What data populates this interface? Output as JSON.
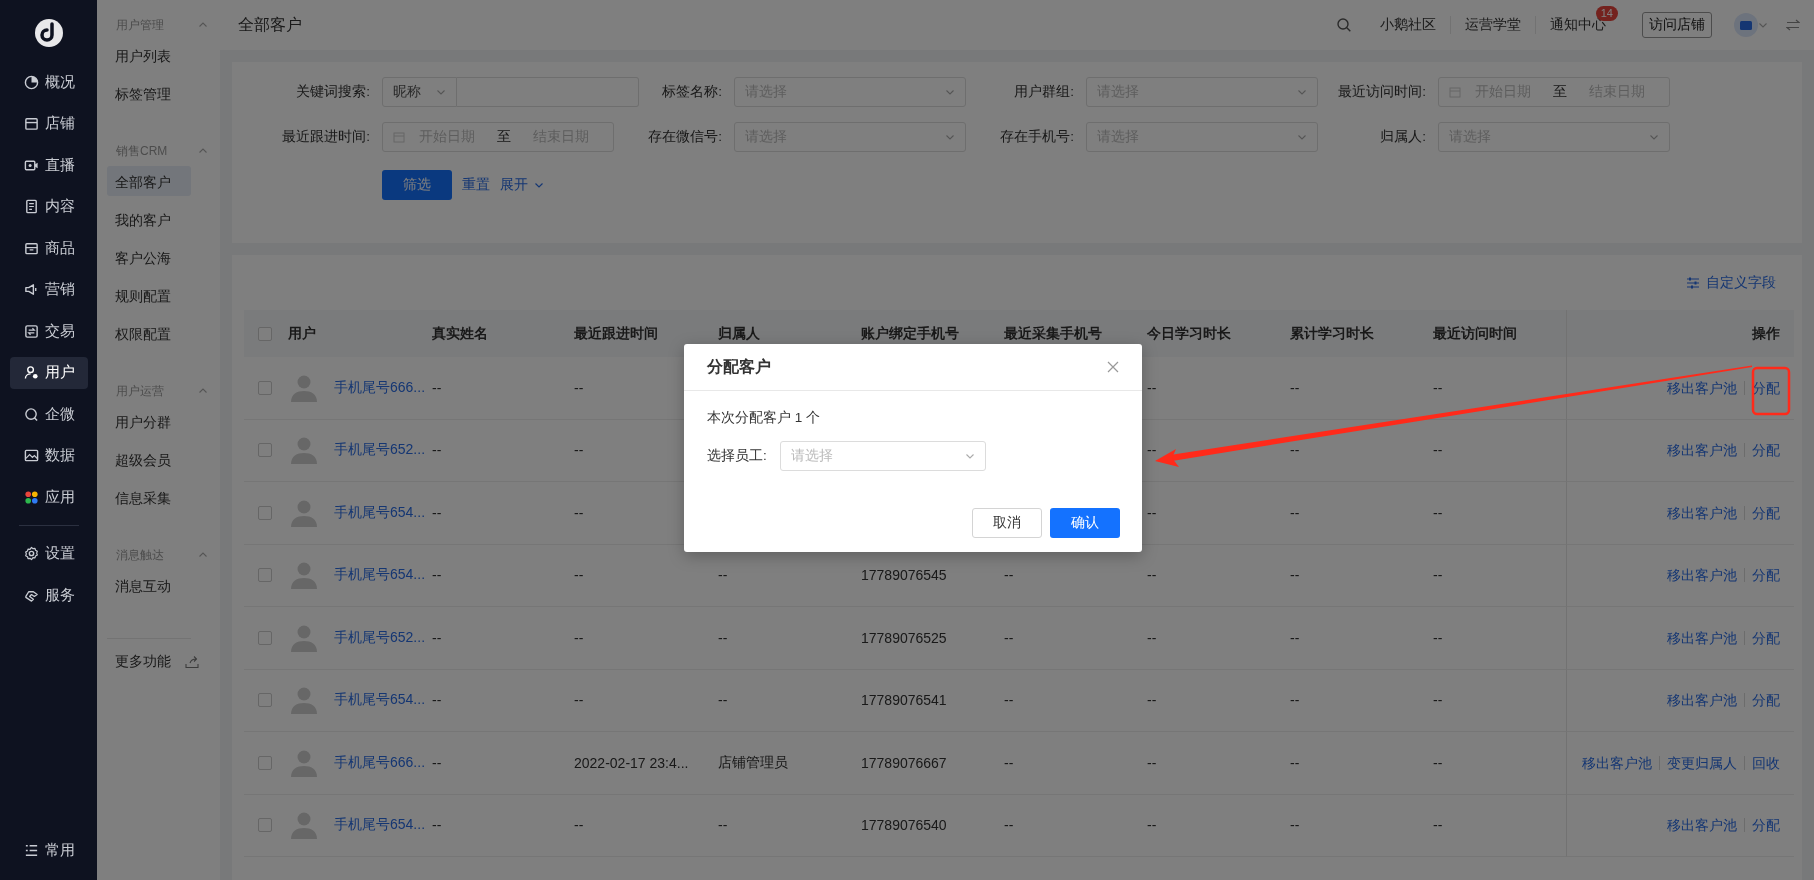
{
  "sidebar": {
    "items": [
      {
        "label": "概况",
        "selected": false
      },
      {
        "label": "店铺",
        "selected": false
      },
      {
        "label": "直播",
        "selected": false
      },
      {
        "label": "内容",
        "selected": false
      },
      {
        "label": "商品",
        "selected": false
      },
      {
        "label": "营销",
        "selected": false
      },
      {
        "label": "交易",
        "selected": false
      },
      {
        "label": "用户",
        "selected": true
      },
      {
        "label": "企微",
        "selected": false
      },
      {
        "label": "数据",
        "selected": false
      },
      {
        "label": "应用",
        "selected": false
      }
    ],
    "settings_items": [
      {
        "label": "设置",
        "selected": false
      },
      {
        "label": "服务",
        "selected": false
      }
    ],
    "bottom_item": "常用"
  },
  "subnav": {
    "groups": [
      {
        "title": "用户管理",
        "expanded": true,
        "items": [
          {
            "label": "用户列表",
            "selected": false
          },
          {
            "label": "标签管理",
            "selected": false
          }
        ]
      },
      {
        "title": "销售CRM",
        "expanded": true,
        "items": [
          {
            "label": "全部客户",
            "selected": true
          },
          {
            "label": "我的客户",
            "selected": false
          },
          {
            "label": "客户公海",
            "selected": false
          },
          {
            "label": "规则配置",
            "selected": false
          },
          {
            "label": "权限配置",
            "selected": false
          }
        ]
      },
      {
        "title": "用户运营",
        "expanded": true,
        "items": [
          {
            "label": "用户分群",
            "selected": false
          },
          {
            "label": "超级会员",
            "selected": false
          },
          {
            "label": "信息采集",
            "selected": false
          }
        ]
      },
      {
        "title": "消息触达",
        "expanded": true,
        "items": [
          {
            "label": "消息互动",
            "selected": false
          }
        ]
      }
    ],
    "more": "更多功能"
  },
  "topbar": {
    "title": "全部客户",
    "links": [
      {
        "label": "小鹅社区"
      },
      {
        "label": "运营学堂"
      },
      {
        "label": "通知中心",
        "badge": "14"
      }
    ],
    "visit_store": "访问店铺"
  },
  "filters": [
    {
      "kind": "keyword",
      "label": "关键词搜索:",
      "select": "昵称"
    },
    {
      "kind": "select",
      "label": "标签名称:",
      "placeholder": "请选择"
    },
    {
      "kind": "select",
      "label": "用户群组:",
      "placeholder": "请选择"
    },
    {
      "kind": "daterange",
      "label": "最近访问时间:",
      "start": "开始日期",
      "separator": "至",
      "end": "结束日期"
    },
    {
      "kind": "daterange",
      "label": "最近跟进时间:",
      "start": "开始日期",
      "separator": "至",
      "end": "结束日期"
    },
    {
      "kind": "select",
      "label": "存在微信号:",
      "placeholder": "请选择"
    },
    {
      "kind": "select",
      "label": "存在手机号:",
      "placeholder": "请选择"
    },
    {
      "kind": "select",
      "label": "归属人:",
      "placeholder": "请选择"
    }
  ],
  "filter_actions": {
    "submit": "筛选",
    "reset": "重置",
    "expand": "展开"
  },
  "table": {
    "customize": "自定义字段",
    "header_checked": false,
    "columns": [
      "用户",
      "真实姓名",
      "最近跟进时间",
      "归属人",
      "账户绑定手机号",
      "最近采集手机号",
      "今日学习时长",
      "累计学习时长",
      "最近访问时间",
      "操作"
    ],
    "rows": [
      {
        "checked": false,
        "user": "手机尾号666...",
        "real_name": "--",
        "follow_time": "--",
        "today_study": "--",
        "total_study": "--",
        "last_visit": "--",
        "actions": [
          "移出客户池",
          "分配"
        ]
      },
      {
        "checked": false,
        "user": "手机尾号652...",
        "real_name": "--",
        "follow_time": "--",
        "today_study": "--",
        "total_study": "--",
        "last_visit": "--",
        "actions": [
          "移出客户池",
          "分配"
        ]
      },
      {
        "checked": false,
        "user": "手机尾号654...",
        "real_name": "--",
        "follow_time": "--",
        "today_study": "--",
        "total_study": "--",
        "last_visit": "--",
        "actions": [
          "移出客户池",
          "分配"
        ]
      },
      {
        "checked": false,
        "user": "手机尾号654...",
        "real_name": "--",
        "follow_time": "--",
        "owner": "--",
        "bound_phone": "17789076545",
        "collected_phone": "--",
        "today_study": "--",
        "total_study": "--",
        "last_visit": "--",
        "actions": [
          "移出客户池",
          "分配"
        ]
      },
      {
        "checked": false,
        "user": "手机尾号652...",
        "real_name": "--",
        "follow_time": "--",
        "owner": "--",
        "bound_phone": "17789076525",
        "collected_phone": "--",
        "today_study": "--",
        "total_study": "--",
        "last_visit": "--",
        "actions": [
          "移出客户池",
          "分配"
        ]
      },
      {
        "checked": false,
        "user": "手机尾号654...",
        "real_name": "--",
        "follow_time": "--",
        "owner": "--",
        "bound_phone": "17789076541",
        "collected_phone": "--",
        "today_study": "--",
        "total_study": "--",
        "last_visit": "--",
        "actions": [
          "移出客户池",
          "分配"
        ]
      },
      {
        "checked": false,
        "user": "手机尾号666...",
        "real_name": "--",
        "follow_time": "2022-02-17 23:4...",
        "owner": "店铺管理员",
        "bound_phone": "17789076667",
        "collected_phone": "--",
        "today_study": "--",
        "total_study": "--",
        "last_visit": "--",
        "actions": [
          "移出客户池",
          "变更归属人",
          "回收"
        ]
      },
      {
        "checked": false,
        "user": "手机尾号654...",
        "real_name": "--",
        "follow_time": "--",
        "owner": "--",
        "bound_phone": "17789076540",
        "collected_phone": "--",
        "today_study": "--",
        "total_study": "--",
        "last_visit": "--",
        "actions": [
          "移出客户池",
          "分配"
        ]
      }
    ]
  },
  "dialog": {
    "title": "分配客户",
    "summary": "本次分配客户 1 个",
    "field_label": "选择员工:",
    "field_placeholder": "请选择",
    "cancel": "取消",
    "confirm": "确认"
  }
}
